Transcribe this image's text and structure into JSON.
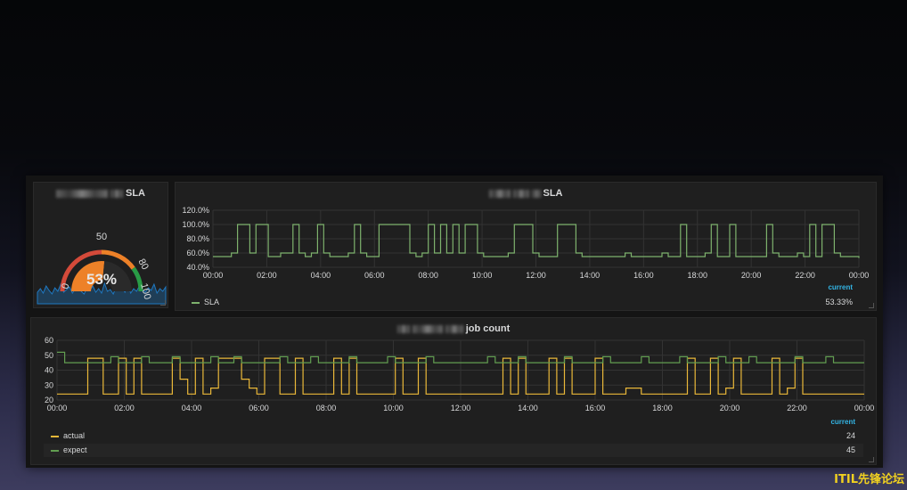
{
  "gauge_panel": {
    "title_suffix": "SLA",
    "value_text": "53%",
    "value": 53,
    "ticks": [
      "0",
      "50",
      "80",
      "100"
    ],
    "colors": {
      "low": "#d44a3a",
      "mid": "#ed8128",
      "high": "#299c46",
      "spark": "#1f78c1"
    }
  },
  "sla_panel": {
    "title_suffix": "SLA",
    "current_header": "current",
    "legend": [
      {
        "name": "SLA",
        "color": "#7eb26d",
        "current": "53.33%"
      }
    ]
  },
  "job_panel": {
    "title_suffix": "job count",
    "current_header": "current",
    "legend": [
      {
        "name": "actual",
        "color": "#eab839",
        "current": "24"
      },
      {
        "name": "expect",
        "color": "#629e51",
        "current": "45"
      }
    ]
  },
  "watermark": "ITIL先锋论坛",
  "chart_data": [
    {
      "type": "line",
      "title": "SLA",
      "x": [
        "00:00",
        "02:00",
        "04:00",
        "06:00",
        "08:00",
        "10:00",
        "12:00",
        "14:00",
        "16:00",
        "18:00",
        "20:00",
        "22:00",
        "00:00"
      ],
      "yticks": [
        "120.0%",
        "100.0%",
        "80.0%",
        "60.0%",
        "40.0%"
      ],
      "ylim": [
        40,
        120
      ],
      "grid": true,
      "series": [
        {
          "name": "SLA",
          "values": [
            55,
            55,
            55,
            60,
            100,
            100,
            60,
            100,
            100,
            55,
            55,
            60,
            60,
            100,
            60,
            55,
            60,
            100,
            60,
            55,
            55,
            55,
            60,
            100,
            60,
            55,
            55,
            100,
            100,
            100,
            100,
            100,
            60,
            55,
            60,
            100,
            60,
            100,
            60,
            100,
            60,
            100,
            100,
            60,
            55,
            55,
            55,
            55,
            60,
            100,
            100,
            100,
            60,
            55,
            55,
            55,
            100,
            100,
            100,
            60,
            55,
            55,
            55,
            55,
            55,
            55,
            55,
            60,
            55,
            55,
            55,
            55,
            55,
            60,
            55,
            55,
            100,
            55,
            55,
            55,
            60,
            100,
            55,
            55,
            100,
            55,
            55,
            55,
            55,
            55,
            100,
            60,
            55,
            55,
            55,
            60,
            55,
            100,
            55,
            100,
            100,
            60,
            55,
            55,
            55,
            53
          ]
        }
      ],
      "current": "53.33%"
    },
    {
      "type": "line",
      "title": "job count",
      "x": [
        "00:00",
        "02:00",
        "04:00",
        "06:00",
        "08:00",
        "10:00",
        "12:00",
        "14:00",
        "16:00",
        "18:00",
        "20:00",
        "22:00",
        "00:00"
      ],
      "yticks": [
        "60",
        "50",
        "40",
        "30",
        "20"
      ],
      "ylim": [
        20,
        60
      ],
      "grid": true,
      "series": [
        {
          "name": "actual",
          "values": [
            24,
            24,
            24,
            24,
            48,
            48,
            24,
            24,
            48,
            24,
            48,
            24,
            24,
            24,
            24,
            48,
            34,
            24,
            48,
            24,
            28,
            48,
            48,
            48,
            34,
            28,
            24,
            48,
            48,
            24,
            24,
            48,
            24,
            24,
            24,
            24,
            48,
            24,
            48,
            24,
            24,
            24,
            24,
            24,
            48,
            24,
            24,
            48,
            24,
            24,
            24,
            24,
            24,
            24,
            24,
            24,
            24,
            24,
            48,
            24,
            48,
            24,
            24,
            24,
            48,
            24,
            48,
            24,
            24,
            24,
            48,
            24,
            24,
            24,
            28,
            28,
            24,
            24,
            24,
            24,
            24,
            24,
            48,
            24,
            24,
            48,
            24,
            28,
            48,
            24,
            24,
            24,
            24,
            48,
            24,
            28,
            48,
            24,
            24,
            24,
            24,
            24,
            24,
            24,
            24,
            24
          ]
        },
        {
          "name": "expect",
          "values": [
            52,
            45,
            45,
            45,
            45,
            45,
            45,
            49,
            45,
            45,
            45,
            49,
            45,
            45,
            45,
            49,
            45,
            45,
            45,
            45,
            49,
            45,
            45,
            49,
            45,
            45,
            45,
            45,
            45,
            49,
            45,
            45,
            45,
            49,
            45,
            45,
            45,
            45,
            49,
            45,
            45,
            45,
            45,
            49,
            45,
            45,
            45,
            45,
            49,
            45,
            45,
            45,
            45,
            45,
            45,
            45,
            49,
            45,
            45,
            45,
            49,
            45,
            45,
            45,
            45,
            45,
            49,
            45,
            45,
            45,
            45,
            49,
            45,
            45,
            45,
            45,
            49,
            45,
            45,
            45,
            45,
            49,
            45,
            45,
            45,
            45,
            49,
            45,
            45,
            45,
            49,
            45,
            45,
            45,
            45,
            45,
            49,
            45,
            45,
            45,
            49,
            45,
            45,
            45,
            45,
            45
          ]
        }
      ],
      "current": {
        "actual": "24",
        "expect": "45"
      }
    }
  ]
}
